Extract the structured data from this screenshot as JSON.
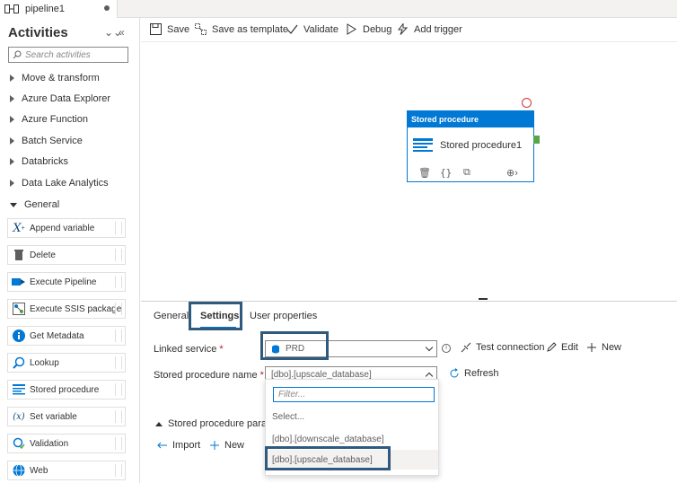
{
  "tab": {
    "title": "pipeline1"
  },
  "sidebar": {
    "title": "Activities",
    "search_placeholder": "Search activities",
    "categories": [
      "Move & transform",
      "Azure Data Explorer",
      "Azure Function",
      "Batch Service",
      "Databricks",
      "Data Lake Analytics"
    ],
    "open_category": "General",
    "activities": [
      {
        "label": "Append variable",
        "icon": "append-variable-icon"
      },
      {
        "label": "Delete",
        "icon": "trash-icon"
      },
      {
        "label": "Execute Pipeline",
        "icon": "execute-pipeline-icon"
      },
      {
        "label": "Execute SSIS package",
        "icon": "ssis-icon"
      },
      {
        "label": "Get Metadata",
        "icon": "info-icon"
      },
      {
        "label": "Lookup",
        "icon": "lookup-icon"
      },
      {
        "label": "Stored procedure",
        "icon": "stored-procedure-icon"
      },
      {
        "label": "Set variable",
        "icon": "set-variable-icon"
      },
      {
        "label": "Validation",
        "icon": "validation-icon"
      },
      {
        "label": "Web",
        "icon": "globe-icon"
      }
    ]
  },
  "toolbar": {
    "save": "Save",
    "save_template": "Save as template",
    "validate": "Validate",
    "debug": "Debug",
    "add_trigger": "Add trigger"
  },
  "canvas": {
    "node": {
      "header": "Stored procedure",
      "name": "Stored procedure1"
    }
  },
  "panel": {
    "tabs": [
      "General",
      "Settings",
      "User properties"
    ],
    "active_tab": "Settings",
    "linked_service_label": "Linked service",
    "linked_service_value": "PRD",
    "test_connection": "Test connection",
    "edit": "Edit",
    "new": "New",
    "sp_name_label": "Stored procedure name",
    "sp_name_value": "[dbo].[upscale_database]",
    "refresh": "Refresh",
    "filter_placeholder": "Filter...",
    "options": [
      "Select...",
      "[dbo].[downscale_database]",
      "[dbo].[upscale_database]"
    ],
    "params_label": "Stored procedure parame",
    "import": "Import",
    "new2": "New"
  },
  "colors": {
    "accent": "#0078d4",
    "highlight": "#2f5a7e",
    "success": "#57a64a",
    "error": "#d13438"
  }
}
